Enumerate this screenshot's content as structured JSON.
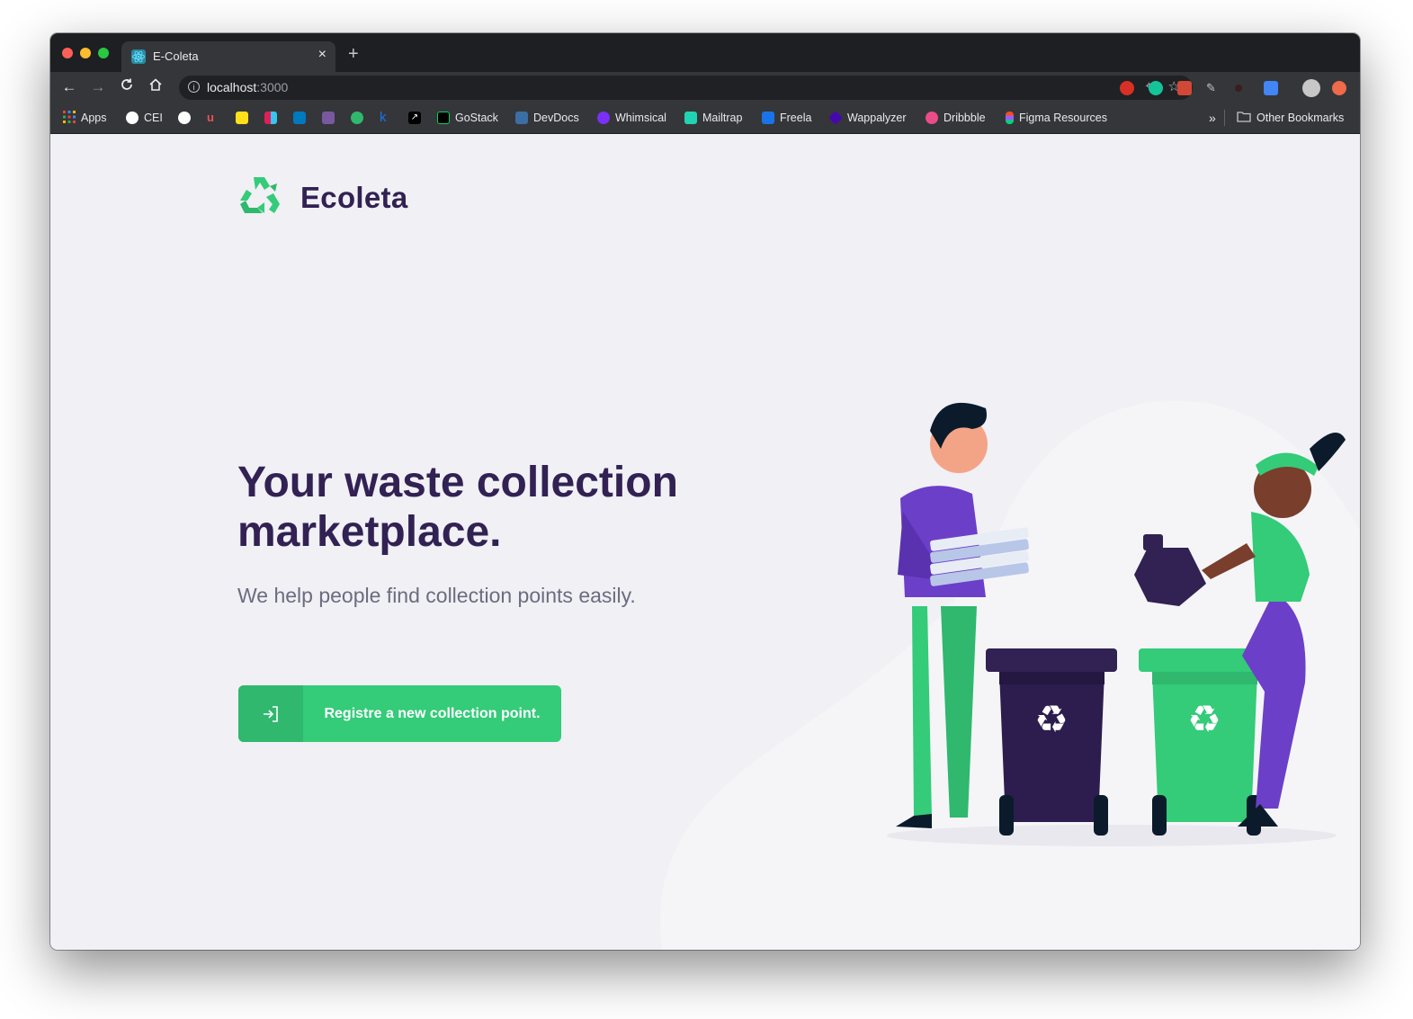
{
  "browser": {
    "tab_title": "E-Coleta",
    "tab_close": "×",
    "new_tab": "+",
    "url_host": "localhost",
    "url_port": ":3000",
    "bookmarks": [
      {
        "label": "Apps",
        "icon": "apps-grid-icon",
        "color": "#ea4335"
      },
      {
        "label": "CEI",
        "icon": "globe-icon",
        "color": "#ffffff"
      },
      {
        "label": "",
        "icon": "github-icon",
        "color": "#ffffff"
      },
      {
        "label": "",
        "icon": "udemy-icon",
        "color": "#ec5252"
      },
      {
        "label": "",
        "icon": "mailchimp-icon",
        "color": "#ffe01b"
      },
      {
        "label": "",
        "icon": "slack-icon",
        "color": "#e01e5a"
      },
      {
        "label": "",
        "icon": "trello-icon",
        "color": "#0079bf"
      },
      {
        "label": "",
        "icon": "heroku-icon",
        "color": "#79589f"
      },
      {
        "label": "",
        "icon": "hackernews-icon",
        "color": "#2fb86e"
      },
      {
        "label": "",
        "icon": "k-icon",
        "color": "#1a73e8"
      },
      {
        "label": "",
        "icon": "arrow-app-icon",
        "color": "#000000"
      },
      {
        "label": "GoStack",
        "icon": "gostack-icon",
        "color": "#04d361"
      },
      {
        "label": "DevDocs",
        "icon": "devdocs-icon",
        "color": "#3b6ea5"
      },
      {
        "label": "Whimsical",
        "icon": "whimsical-icon",
        "color": "#7b2ff7"
      },
      {
        "label": "Mailtrap",
        "icon": "mailtrap-icon",
        "color": "#22d3b3"
      },
      {
        "label": "Freela",
        "icon": "freela-icon",
        "color": "#1a73e8"
      },
      {
        "label": "Wappalyzer",
        "icon": "wappalyzer-icon",
        "color": "#4608ad"
      },
      {
        "label": "Dribbble",
        "icon": "dribbble-icon",
        "color": "#ea4c89"
      },
      {
        "label": "Figma Resources",
        "icon": "figma-icon",
        "color": "#f24e1e"
      }
    ],
    "overflow_chevron": "»",
    "other_bookmarks": "Other Bookmarks"
  },
  "page": {
    "logo_text": "Ecoleta",
    "headline": "Your waste collection marketplace.",
    "subheadline": "We help people find collection points easily.",
    "cta_label": "Registre a new collection point."
  },
  "colors": {
    "primary": "#34cb79",
    "title": "#322153",
    "text": "#6c6c80",
    "background": "#f0f0f5"
  }
}
